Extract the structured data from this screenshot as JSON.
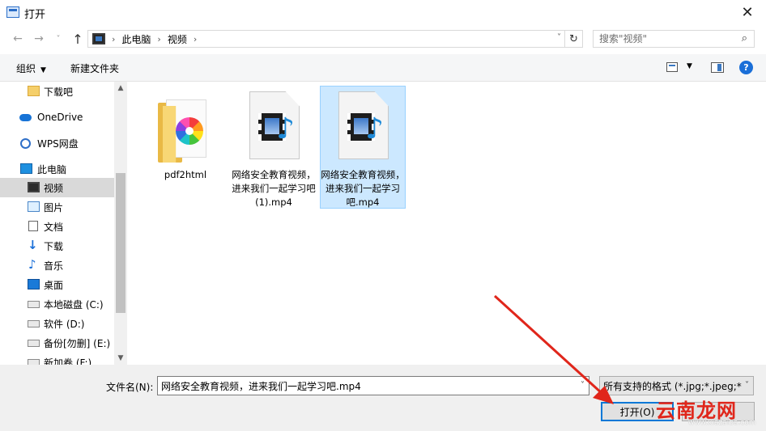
{
  "window": {
    "title": "打开",
    "close_label": "✕"
  },
  "address": {
    "crumbs": [
      "此电脑",
      "视频"
    ],
    "separator": "›"
  },
  "search": {
    "placeholder": "搜索\"视频\""
  },
  "toolbar": {
    "organize_label": "组织",
    "new_folder_label": "新建文件夹",
    "help_label": "?"
  },
  "nav": {
    "items": [
      {
        "label": "下载吧",
        "icon": "folder-icon"
      },
      {
        "label": "OneDrive",
        "icon": "cloud-icon"
      },
      {
        "label": "WPS网盘",
        "icon": "wps-icon"
      },
      {
        "label": "此电脑",
        "icon": "computer-icon"
      },
      {
        "label": "视频",
        "icon": "video-icon",
        "selected": true
      },
      {
        "label": "图片",
        "icon": "picture-icon"
      },
      {
        "label": "文档",
        "icon": "document-icon"
      },
      {
        "label": "下载",
        "icon": "download-icon"
      },
      {
        "label": "音乐",
        "icon": "music-icon"
      },
      {
        "label": "桌面",
        "icon": "desktop-icon"
      },
      {
        "label": "本地磁盘 (C:)",
        "icon": "drive-icon"
      },
      {
        "label": "软件 (D:)",
        "icon": "drive-icon"
      },
      {
        "label": "备份[勿删] (E:)",
        "icon": "drive-icon"
      },
      {
        "label": "新加卷 (F:)",
        "icon": "drive-icon"
      }
    ]
  },
  "files": [
    {
      "name": "pdf2html",
      "icon": "folder-icon"
    },
    {
      "name": "网络安全教育视频，进来我们一起学习吧(1).mp4",
      "icon": "media-file-icon"
    },
    {
      "name": "网络安全教育视频，进来我们一起学习吧.mp4",
      "icon": "media-file-icon",
      "selected": true
    }
  ],
  "footer": {
    "filename_label": "文件名(N):",
    "filename_value": "网络安全教育视频，进来我们一起学习吧.mp4",
    "filter_value": "所有支持的格式 (*.jpg;*.jpeg;*",
    "open_label": "打开(O)"
  },
  "watermark": {
    "text": "云南龙网",
    "url": "www.xiazaiba.com"
  },
  "colors": {
    "accent": "#0078d7",
    "selection": "#cce8ff",
    "arrow": "#e0261b"
  }
}
